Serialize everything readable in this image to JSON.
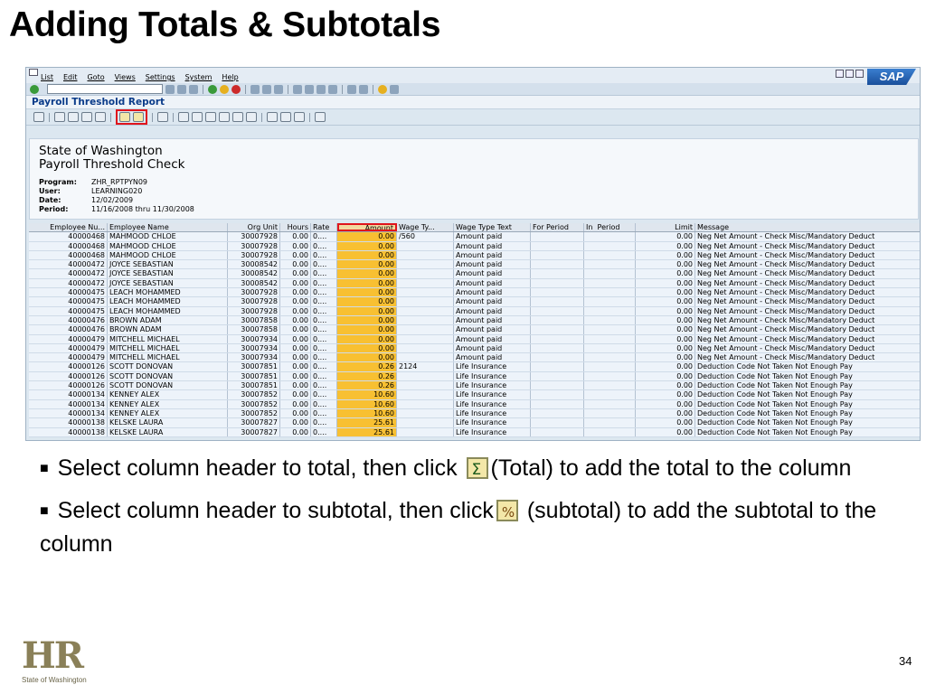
{
  "slide": {
    "title": "Adding Totals & Subtotals",
    "page_number": "34"
  },
  "sap": {
    "menu": [
      "List",
      "Edit",
      "Goto",
      "Views",
      "Settings",
      "System",
      "Help"
    ],
    "logo": "SAP",
    "report_title": "Payroll Threshold Report",
    "header_lines": [
      "State of Washington",
      "Payroll Threshold Check"
    ],
    "meta": [
      {
        "label": "Program:",
        "value": "ZHR_RPTPYN09"
      },
      {
        "label": "User:",
        "value": "LEARNING020"
      },
      {
        "label": "Date:",
        "value": "12/02/2009"
      },
      {
        "label": "Period:",
        "value": "11/16/2008 thru 11/30/2008"
      }
    ],
    "columns": [
      "Employee Nu...",
      "Employee Name",
      "Org Unit",
      "Hours",
      "Rate",
      "Amount",
      "Wage Ty...",
      "Wage Type Text",
      "For Period",
      "In",
      "Period",
      "Limit",
      "Message"
    ],
    "rows": [
      [
        "40000468",
        "MAHMOOD CHLOE",
        "30007928",
        "0.00",
        "0....",
        "0.00",
        "/560",
        "Amount paid",
        "",
        "",
        "0.00",
        "Neg Net Amount - Check Misc/Mandatory Deduct"
      ],
      [
        "40000468",
        "MAHMOOD CHLOE",
        "30007928",
        "0.00",
        "0....",
        "0.00",
        "",
        "Amount paid",
        "",
        "",
        "0.00",
        "Neg Net Amount - Check Misc/Mandatory Deduct"
      ],
      [
        "40000468",
        "MAHMOOD CHLOE",
        "30007928",
        "0.00",
        "0....",
        "0.00",
        "",
        "Amount paid",
        "",
        "",
        "0.00",
        "Neg Net Amount - Check Misc/Mandatory Deduct"
      ],
      [
        "40000472",
        "JOYCE SEBASTIAN",
        "30008542",
        "0.00",
        "0....",
        "0.00",
        "",
        "Amount paid",
        "",
        "",
        "0.00",
        "Neg Net Amount - Check Misc/Mandatory Deduct"
      ],
      [
        "40000472",
        "JOYCE SEBASTIAN",
        "30008542",
        "0.00",
        "0....",
        "0.00",
        "",
        "Amount paid",
        "",
        "",
        "0.00",
        "Neg Net Amount - Check Misc/Mandatory Deduct"
      ],
      [
        "40000472",
        "JOYCE SEBASTIAN",
        "30008542",
        "0.00",
        "0....",
        "0.00",
        "",
        "Amount paid",
        "",
        "",
        "0.00",
        "Neg Net Amount - Check Misc/Mandatory Deduct"
      ],
      [
        "40000475",
        "LEACH MOHAMMED",
        "30007928",
        "0.00",
        "0....",
        "0.00",
        "",
        "Amount paid",
        "",
        "",
        "0.00",
        "Neg Net Amount - Check Misc/Mandatory Deduct"
      ],
      [
        "40000475",
        "LEACH MOHAMMED",
        "30007928",
        "0.00",
        "0....",
        "0.00",
        "",
        "Amount paid",
        "",
        "",
        "0.00",
        "Neg Net Amount - Check Misc/Mandatory Deduct"
      ],
      [
        "40000475",
        "LEACH MOHAMMED",
        "30007928",
        "0.00",
        "0....",
        "0.00",
        "",
        "Amount paid",
        "",
        "",
        "0.00",
        "Neg Net Amount - Check Misc/Mandatory Deduct"
      ],
      [
        "40000476",
        "BROWN ADAM",
        "30007858",
        "0.00",
        "0....",
        "0.00",
        "",
        "Amount paid",
        "",
        "",
        "0.00",
        "Neg Net Amount - Check Misc/Mandatory Deduct"
      ],
      [
        "40000476",
        "BROWN ADAM",
        "30007858",
        "0.00",
        "0....",
        "0.00",
        "",
        "Amount paid",
        "",
        "",
        "0.00",
        "Neg Net Amount - Check Misc/Mandatory Deduct"
      ],
      [
        "40000479",
        "MITCHELL MICHAEL",
        "30007934",
        "0.00",
        "0....",
        "0.00",
        "",
        "Amount paid",
        "",
        "",
        "0.00",
        "Neg Net Amount - Check Misc/Mandatory Deduct"
      ],
      [
        "40000479",
        "MITCHELL MICHAEL",
        "30007934",
        "0.00",
        "0....",
        "0.00",
        "",
        "Amount paid",
        "",
        "",
        "0.00",
        "Neg Net Amount - Check Misc/Mandatory Deduct"
      ],
      [
        "40000479",
        "MITCHELL MICHAEL",
        "30007934",
        "0.00",
        "0....",
        "0.00",
        "",
        "Amount paid",
        "",
        "",
        "0.00",
        "Neg Net Amount - Check Misc/Mandatory Deduct"
      ],
      [
        "40000126",
        "SCOTT DONOVAN",
        "30007851",
        "0.00",
        "0....",
        "0.26",
        "2124",
        "Life Insurance",
        "",
        "",
        "0.00",
        "Deduction Code Not Taken Not Enough Pay"
      ],
      [
        "40000126",
        "SCOTT DONOVAN",
        "30007851",
        "0.00",
        "0....",
        "0.26",
        "",
        "Life Insurance",
        "",
        "",
        "0.00",
        "Deduction Code Not Taken Not Enough Pay"
      ],
      [
        "40000126",
        "SCOTT DONOVAN",
        "30007851",
        "0.00",
        "0....",
        "0.26",
        "",
        "Life Insurance",
        "",
        "",
        "0.00",
        "Deduction Code Not Taken Not Enough Pay"
      ],
      [
        "40000134",
        "KENNEY ALEX",
        "30007852",
        "0.00",
        "0....",
        "10.60",
        "",
        "Life Insurance",
        "",
        "",
        "0.00",
        "Deduction Code Not Taken Not Enough Pay"
      ],
      [
        "40000134",
        "KENNEY ALEX",
        "30007852",
        "0.00",
        "0....",
        "10.60",
        "",
        "Life Insurance",
        "",
        "",
        "0.00",
        "Deduction Code Not Taken Not Enough Pay"
      ],
      [
        "40000134",
        "KENNEY ALEX",
        "30007852",
        "0.00",
        "0....",
        "10.60",
        "",
        "Life Insurance",
        "",
        "",
        "0.00",
        "Deduction Code Not Taken Not Enough Pay"
      ],
      [
        "40000138",
        "KELSKE LAURA",
        "30007827",
        "0.00",
        "0....",
        "25.61",
        "",
        "Life Insurance",
        "",
        "",
        "0.00",
        "Deduction Code Not Taken Not Enough Pay"
      ],
      [
        "40000138",
        "KELSKE LAURA",
        "30007827",
        "0.00",
        "0....",
        "25.61",
        "",
        "Life Insurance",
        "",
        "",
        "0.00",
        "Deduction Code Not Taken Not Enough Pay"
      ]
    ]
  },
  "bullets": [
    {
      "before": "Select column header to total, then click ",
      "icon": "total-icon",
      "after": "(Total) to add the total to the column"
    },
    {
      "before": "Select column header to subtotal, then click",
      "icon": "subtotal-icon",
      "after": " (subtotal)  to add the subtotal to the column"
    }
  ],
  "logo": {
    "text": "HR",
    "caption": "State of Washington"
  },
  "colors": {
    "amount_column": "#f8c032",
    "highlight": "#e0141c",
    "title_blue": "#0b3c8a"
  }
}
